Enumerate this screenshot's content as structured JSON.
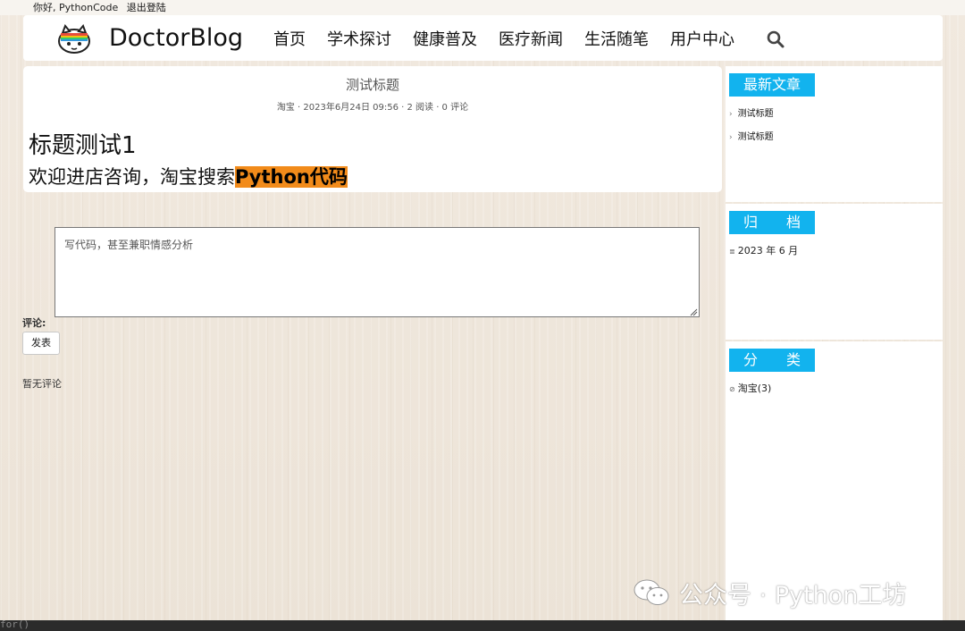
{
  "topbar": {
    "greeting": "你好, PythonCode",
    "logout": "退出登陆"
  },
  "nav": {
    "brand": "DoctorBlog",
    "items": [
      "首页",
      "学术探讨",
      "健康普及",
      "医疗新闻",
      "生活随笔",
      "用户中心"
    ],
    "search_icon": "search-icon"
  },
  "article": {
    "title": "测试标题",
    "meta": "淘宝 · 2023年6月24日 09:56 · 2 阅读 · 0 评论",
    "heading1": "标题测试1",
    "heading2_plain": "欢迎进店咨询，淘宝搜索",
    "heading2_highlight": "Python代码",
    "highlight_color": "#f28b1a"
  },
  "comment": {
    "textarea_value": "写代码，甚至兼职情感分析",
    "label": "评论:",
    "submit": "发表",
    "empty": "暂无评论"
  },
  "sidebar": {
    "accent_color": "#12b3ee",
    "latest": {
      "title": "最新文章",
      "items": [
        "测试标题",
        "测试标题"
      ]
    },
    "archive": {
      "title": "归　　档",
      "items": [
        "2023 年 6 月"
      ]
    },
    "category": {
      "title": "分　　类",
      "items": [
        "淘宝(3)"
      ]
    }
  },
  "terminal_text": "for()",
  "watermark": "公众号 · Python工坊"
}
